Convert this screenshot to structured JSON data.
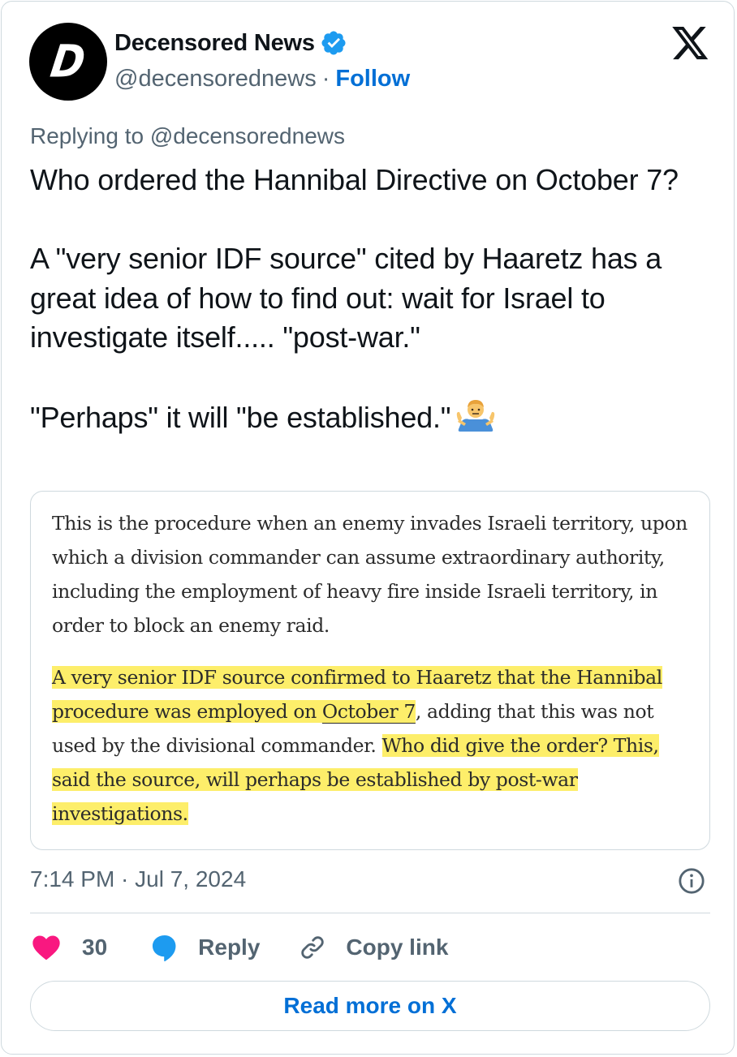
{
  "author": {
    "avatar_letter": "D",
    "name": "Decensored News",
    "handle": "@decensorednews",
    "separator": "·",
    "follow_label": "Follow",
    "verified": true
  },
  "tweet": {
    "replying_to": "Replying to @decensorednews",
    "text": "Who ordered the Hannibal Directive on October 7?\n\nA \"very senior IDF source\" cited by Haaretz has a great idea of how to find out: wait for Israel to investigate itself..... \"post-war.\"\n\n\"Perhaps\" it will \"be established.\"",
    "emoji_icon": "person-shrugging-icon"
  },
  "article_image": {
    "paragraph1": "This is the procedure when an enemy invades Israeli territory, upon which a division commander can assume extraordinary authority, including the employment of heavy fire inside Israeli territory, in order to block an enemy raid.",
    "p2_highlight_a": "A very senior IDF source confirmed to Haaretz that the Hannibal procedure was employed on ",
    "p2_highlight_link": "October 7",
    "p2_plain": ", adding that this was not used by the divisional commander. ",
    "p2_highlight_b": "Who did give the order? This, said the source, will perhaps be established by post-war investigations.",
    "highlight_color": "#fdee6a"
  },
  "meta": {
    "timestamp": "7:14 PM · Jul 7, 2024"
  },
  "actions": {
    "like_count": "30",
    "reply_label": "Reply",
    "copy_link_label": "Copy link"
  },
  "read_more_label": "Read more on X",
  "colors": {
    "accent": "#006fd6",
    "verified": "#1d9bf0",
    "like": "#f91880",
    "muted": "#536471",
    "text": "#0f1419"
  }
}
